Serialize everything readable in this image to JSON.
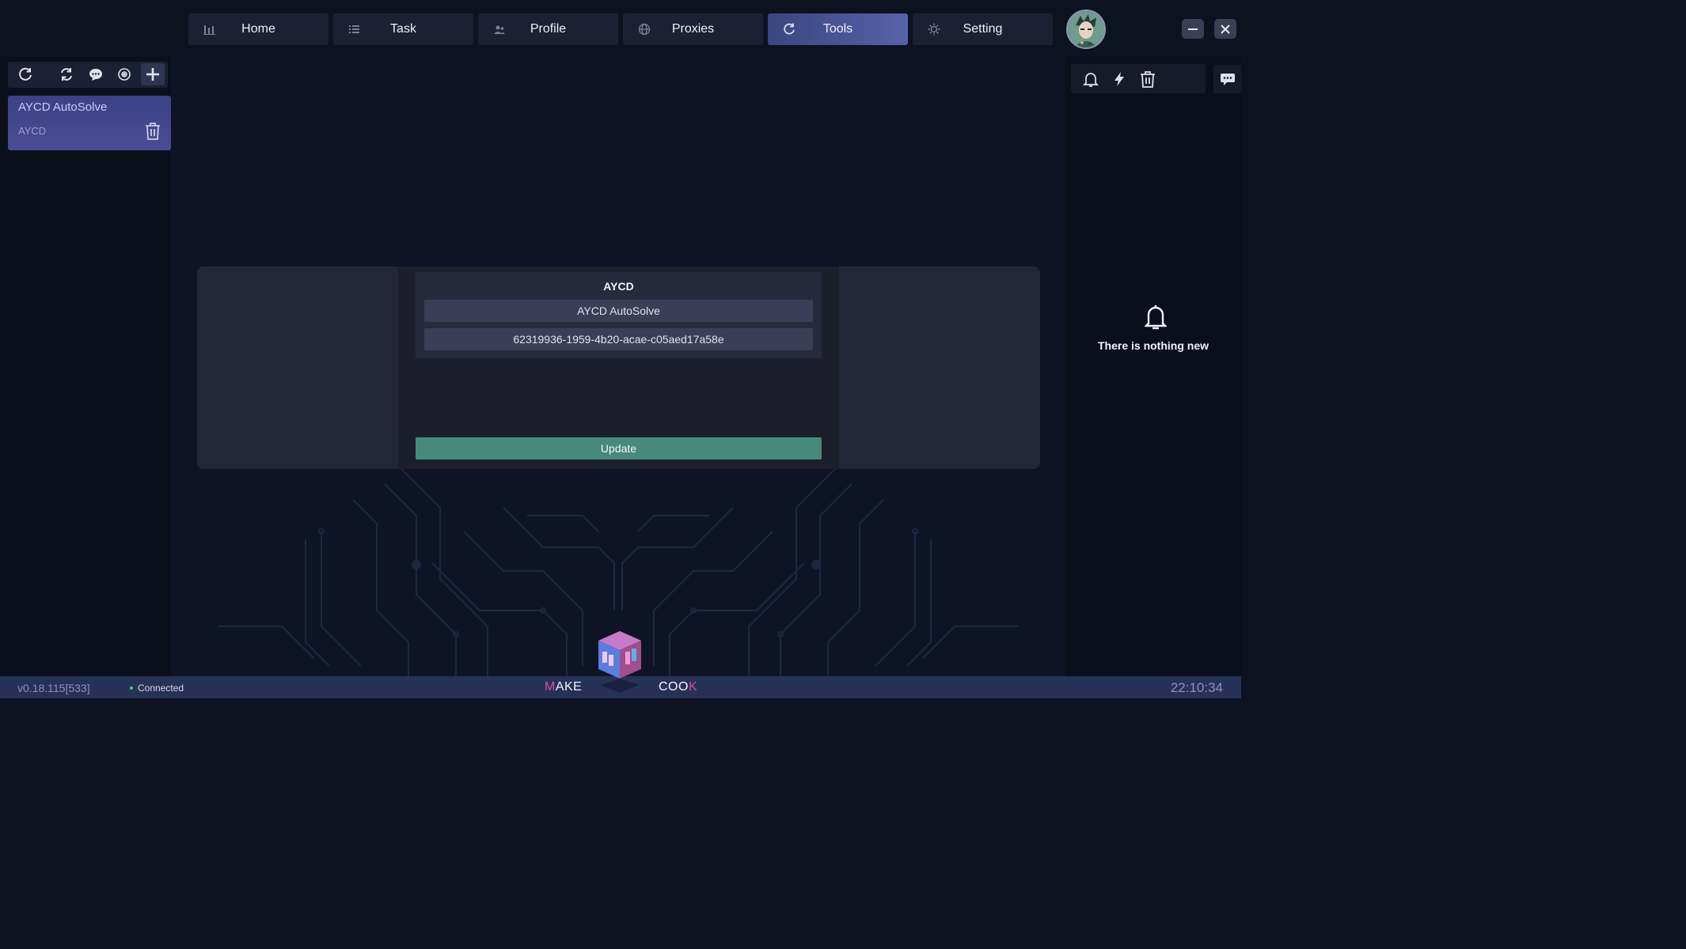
{
  "nav": {
    "tabs": [
      {
        "label": "Home",
        "icon": "bar-chart-icon"
      },
      {
        "label": "Task",
        "icon": "list-icon"
      },
      {
        "label": "Profile",
        "icon": "users-icon"
      },
      {
        "label": "Proxies",
        "icon": "globe-icon"
      },
      {
        "label": "Tools",
        "icon": "refresh-icon",
        "active": true
      },
      {
        "label": "Setting",
        "icon": "gear-icon"
      }
    ]
  },
  "sidebar": {
    "toolbar_icons": [
      "refresh-icon",
      "sync-icon",
      "chat-icon",
      "target-icon",
      "plus-icon"
    ],
    "items": [
      {
        "title": "AYCD AutoSolve",
        "subtitle": "AYCD"
      }
    ]
  },
  "form": {
    "title": "AYCD",
    "name_value": "AYCD AutoSolve",
    "key_value": "62319936-1959-4b20-acae-c05aed17a58e",
    "update_label": "Update"
  },
  "notifications": {
    "toolbar_icons": [
      "bell-icon",
      "bolt-icon",
      "trash-icon"
    ],
    "empty_text": "There is nothing new"
  },
  "footer": {
    "version": "v0.18.115[533]",
    "status": "Connected",
    "brand_left": {
      "accent": "M",
      "rest": "AKE"
    },
    "brand_right": {
      "rest": "COO",
      "accent": "K"
    },
    "clock": "22:10:34"
  },
  "colors": {
    "accent": "#4a52a0",
    "update_button": "#478a7b",
    "status_connected": "#4ecb71",
    "brand_accent": "#d84d9e"
  }
}
